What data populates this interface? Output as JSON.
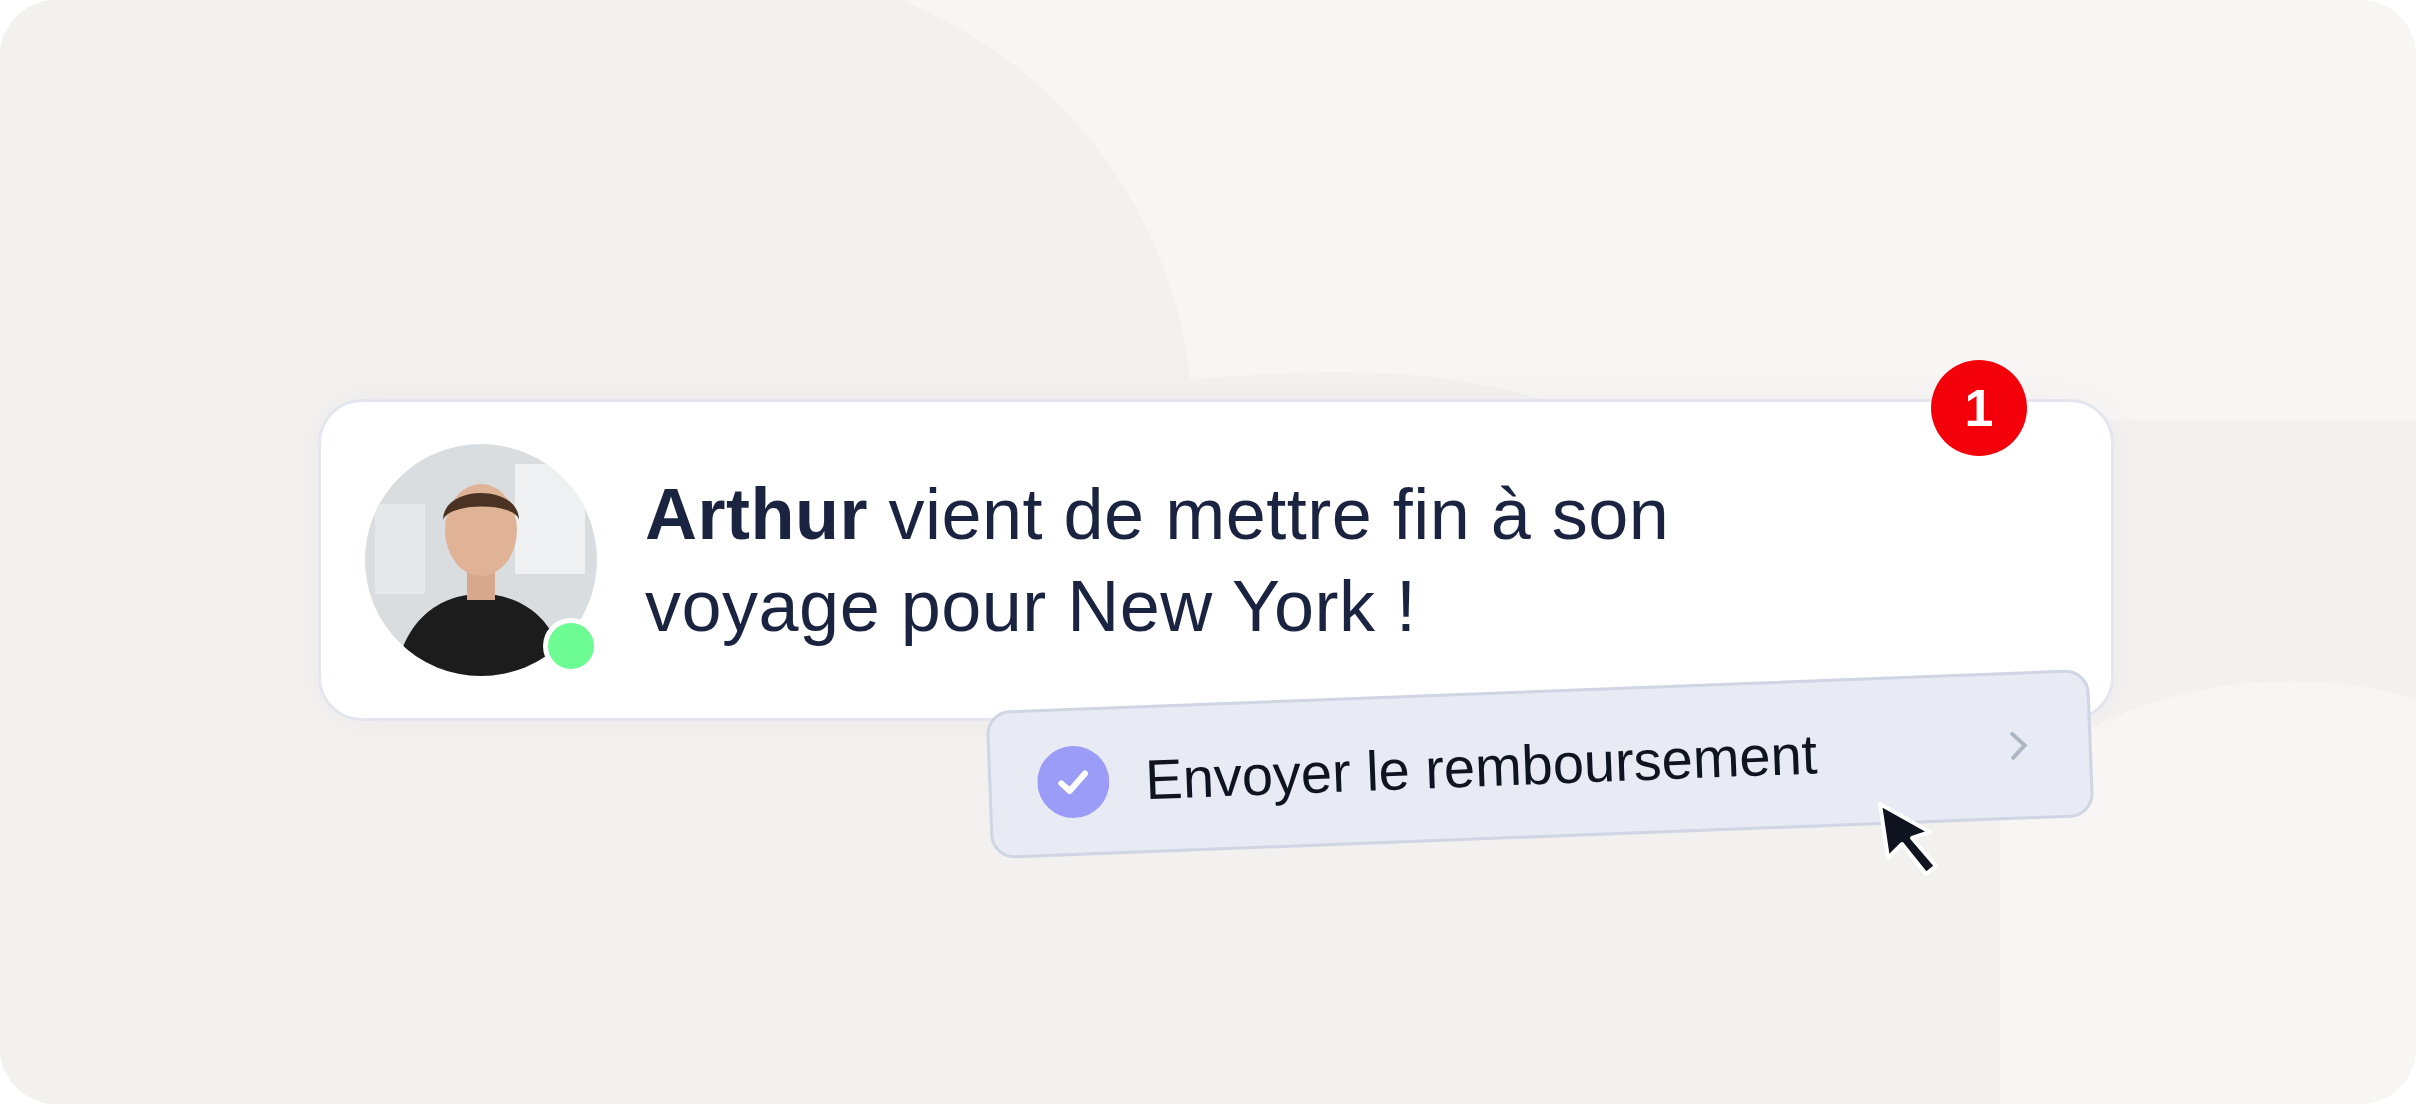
{
  "notification": {
    "message": "**Arthur** vient de mettre fin à son voyage pour New York !",
    "online": true,
    "badge": "1"
  },
  "action_button": {
    "label": "Envoyer le remboursement",
    "checked": true
  }
}
